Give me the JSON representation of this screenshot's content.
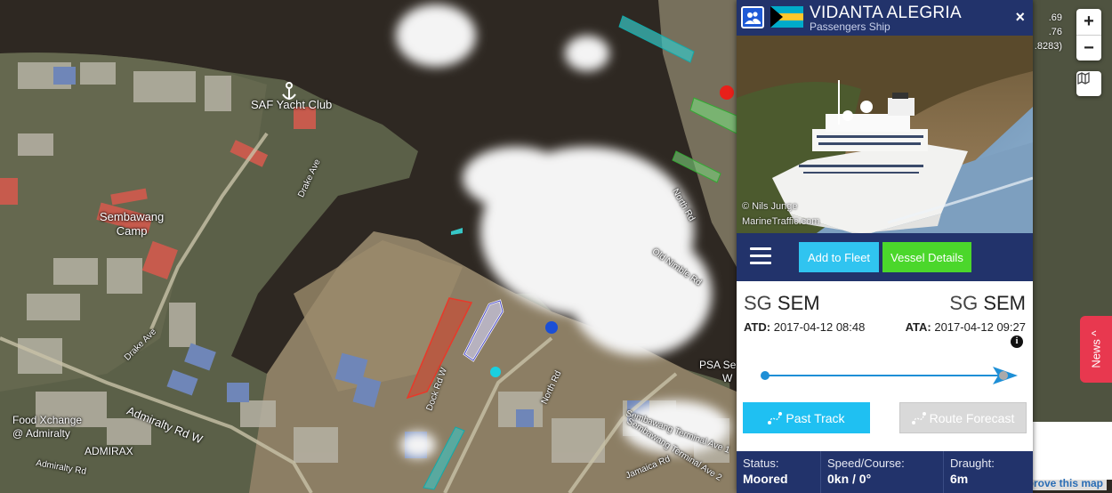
{
  "map": {
    "labels": {
      "yacht_club": "SAF Yacht Club",
      "sembawang_camp": "Sembawang\nCamp",
      "drake_ave_1": "Drake Ave",
      "drake_ave_2": "Drake Ave",
      "north_rd_1": "North Rd",
      "north_rd_2": "North Rd",
      "old_nimble_rd": "Old Nimble Rd",
      "dock_rd_w": "Dock Rd W",
      "admiralty_rd_w": "Admiralty Rd W",
      "admiralty_rd": "Admiralty Rd",
      "food_xchange": "Food Xchange\n@ Admiralty",
      "admirax": "ADMIRAX",
      "psa": "PSA Se",
      "psa2": "W",
      "sembawang_terminal_1": "Sembawang Terminal Ave 1",
      "sembawang_terminal_2": "Sembawang Terminal Ave 2",
      "jamaica_rd": "Jamaica Rd"
    },
    "coords": {
      "line1": ".69",
      "line2": ".76",
      "line3": ".8283)"
    },
    "zoom_in": "+",
    "zoom_out": "−",
    "news_label": "News ^",
    "improve_label": "Improve this map"
  },
  "vessel": {
    "name": "VIDANTA ALEGRIA",
    "type": "Passengers Ship",
    "close": "×",
    "photo_credit_1": "© Nils Junge",
    "photo_credit_2": "MarineTraffic.com",
    "add_to_fleet": "Add to Fleet",
    "vessel_details": "Vessel Details",
    "from_cc": "SG",
    "from_port": "SEM",
    "to_cc": "SG",
    "to_port": "SEM",
    "atd_label": "ATD:",
    "atd_value": "2017-04-12 08:48",
    "ata_label": "ATA:",
    "ata_value": "2017-04-12 09:27",
    "info": "i",
    "voyage_progress": 1.0,
    "past_track": "Past Track",
    "route_forecast": "Route Forecast",
    "status_label": "Status:",
    "status_value": "Moored",
    "speed_label": "Speed/Course:",
    "speed_value": "0kn / 0°",
    "draught_label": "Draught:",
    "draught_value": "6m",
    "flag_colors": {
      "blue": "#00abc9",
      "yellow": "#ffc72c",
      "black": "#000000"
    }
  }
}
